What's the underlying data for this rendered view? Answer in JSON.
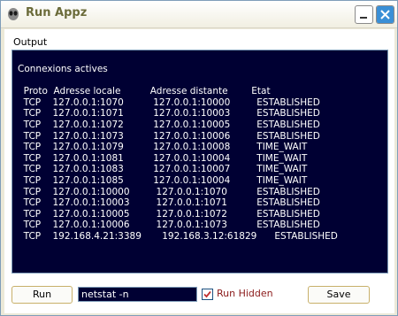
{
  "window": {
    "title": "Run Appz",
    "icons": {
      "app": "alien-icon",
      "minimize": "minimize-icon",
      "close": "close-icon"
    }
  },
  "output": {
    "label": "Output",
    "lines": [
      "Connexions actives",
      "",
      "  Proto  Adresse locale          Adresse distante        Etat",
      "  TCP    127.0.0.1:1070          127.0.0.1:10000         ESTABLISHED",
      "  TCP    127.0.0.1:1071          127.0.0.1:10003         ESTABLISHED",
      "  TCP    127.0.0.1:1072          127.0.0.1:10005         ESTABLISHED",
      "  TCP    127.0.0.1:1073          127.0.0.1:10006         ESTABLISHED",
      "  TCP    127.0.0.1:1079          127.0.0.1:10008         TIME_WAIT",
      "  TCP    127.0.0.1:1081          127.0.0.1:10004         TIME_WAIT",
      "  TCP    127.0.0.1:1083          127.0.0.1:10007         TIME_WAIT",
      "  TCP    127.0.0.1:1085          127.0.0.1:10004         TIME_WAIT",
      "  TCP    127.0.0.1:10000         127.0.0.1:1070          ESTABLISHED",
      "  TCP    127.0.0.1:10003         127.0.0.1:1071          ESTABLISHED",
      "  TCP    127.0.0.1:10005         127.0.0.1:1072          ESTABLISHED",
      "  TCP    127.0.0.1:10006         127.0.0.1:1073          ESTABLISHED",
      "  TCP    192.168.4.21:3389       192.168.3.12:61829      ESTABLISHED"
    ]
  },
  "controls": {
    "run_label": "Run",
    "command_value": "netstat -n",
    "run_hidden_label": "Run Hidden",
    "run_hidden_checked": true,
    "save_label": "Save"
  },
  "colors": {
    "output_bg": "#000033",
    "output_text": "#ffffff",
    "checkbox_label": "#8b1a1a",
    "button_border": "#c8b06a"
  }
}
